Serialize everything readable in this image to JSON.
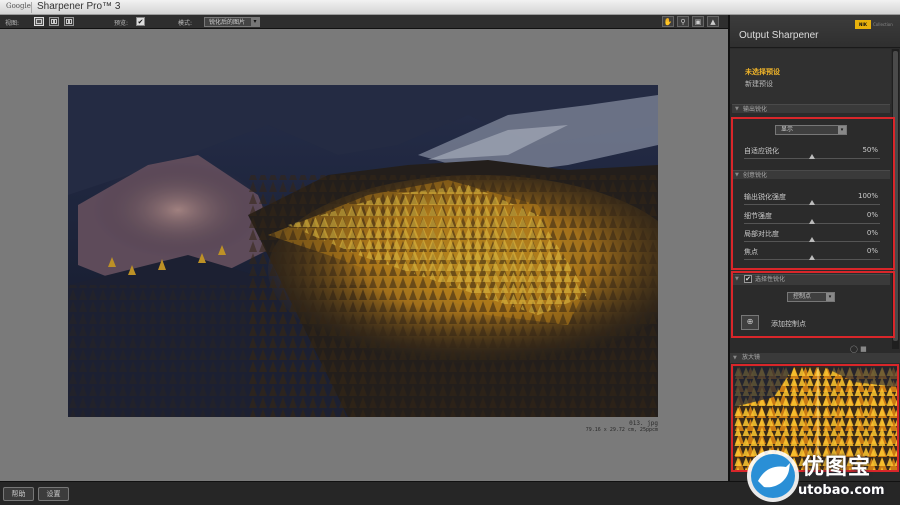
{
  "titlebar": {
    "brand": "Google",
    "product": "Sharpener Pro™ 3"
  },
  "toolbar": {
    "view_label": "视图:",
    "preview_label": "预览:",
    "preview_checked": "✔",
    "mode_label": "模式:",
    "mode_value": "锐化后的图片",
    "icons": [
      "single-view-icon",
      "split-view-icon",
      "side-by-side-view-icon",
      "hand-icon",
      "zoom-icon",
      "color-picker-icon",
      "info-icon"
    ]
  },
  "canvas": {
    "file_name": "013. jpg",
    "file_size": "79.16 x 29.72 cm, 25ppcm"
  },
  "bottom": {
    "help_label": "帮助",
    "settings_label": "设置"
  },
  "panel": {
    "title": "Output Sharpener",
    "logo": "NIK",
    "logo_sub": "Collection",
    "preset_active": "未选择预设",
    "preset_new": "新建预设",
    "output_section": "输出锐化",
    "output_type": "显示",
    "adaptive_label": "自适应锐化",
    "adaptive_value": "50%",
    "creative_section": "创意锐化",
    "sliders": [
      {
        "label": "输出锐化强度",
        "value": "100%",
        "level": 0.5
      },
      {
        "label": "细节强度",
        "value": "0%",
        "level": 0.5
      },
      {
        "label": "局部对比度",
        "value": "0%",
        "level": 0.5
      },
      {
        "label": "焦点",
        "value": "0%",
        "level": 0.5
      }
    ],
    "adaptive_level": 0.5,
    "selective_section": "选择性锐化",
    "selective_checked": "✔",
    "control_point_select": "控制点",
    "add_control_point": "添加控制点",
    "loupe_section": "放大镜"
  },
  "watermark": {
    "text": "优图宝",
    "url": "utobao.com"
  },
  "colors": {
    "accent": "#f0b429",
    "highlight_box": "#d9262a"
  }
}
